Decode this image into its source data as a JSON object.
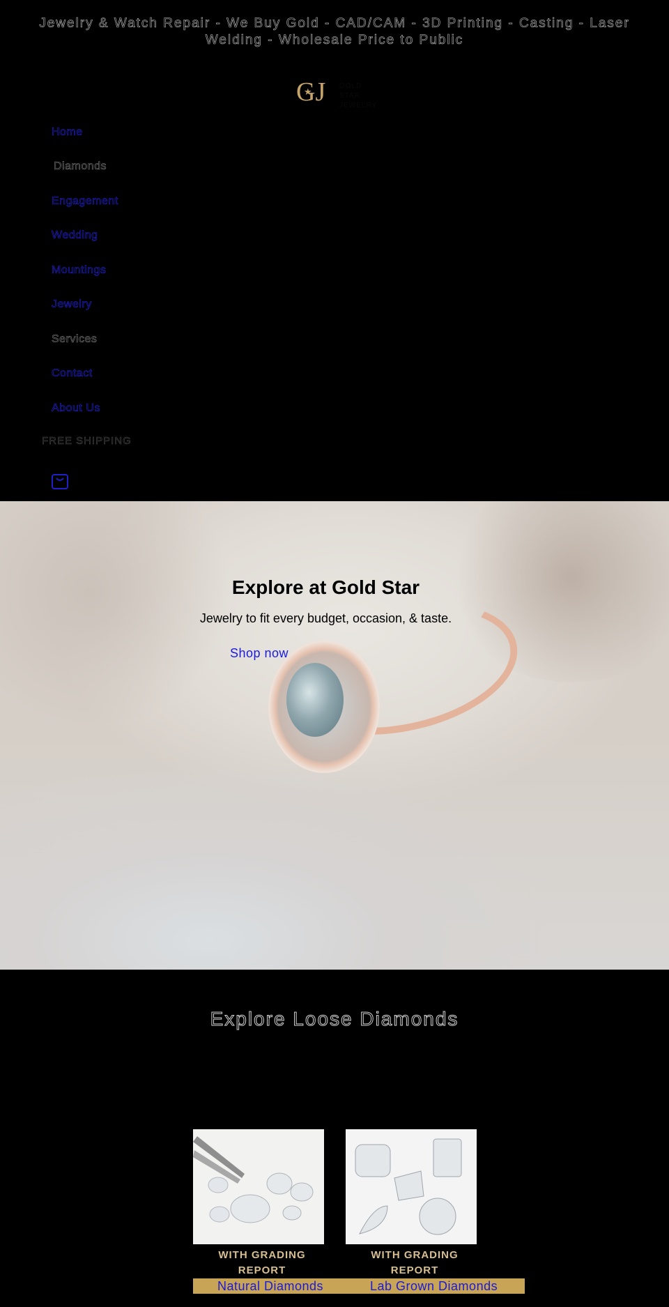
{
  "announcement": "Jewelry & Watch Repair - We Buy Gold - CAD/CAM - 3D Printing - Casting - Laser Welding - Wholesale Price to Public",
  "logo": {
    "mark": "GJ",
    "line1": "GOLD STAR",
    "line2": "JEWELRY"
  },
  "nav": {
    "items": [
      {
        "label": "Home"
      },
      {
        "label": "Diamonds"
      },
      {
        "label": "Engagement"
      },
      {
        "label": "Wedding"
      },
      {
        "label": "Mountings"
      },
      {
        "label": "Jewelry"
      },
      {
        "label": "Services"
      },
      {
        "label": "Contact"
      },
      {
        "label": "About Us"
      }
    ],
    "free_shipping": "FREE SHIPPING",
    "cart_icon": "shopping-bag-icon"
  },
  "hero": {
    "title": "Explore at Gold Star",
    "subtitle": "Jewelry to fit every budget, occasion, & taste.",
    "cta": "Shop now"
  },
  "loose_diamonds": {
    "title": "Explore Loose Diamonds",
    "cards": [
      {
        "label": "WITH GRADING REPORT",
        "link": "Natural Diamonds"
      },
      {
        "label": "WITH GRADING REPORT",
        "link": "Lab Grown Diamonds"
      }
    ]
  },
  "colors": {
    "background": "#000000",
    "gold": "#c7a456",
    "link_blue": "#1a1ae0",
    "label_gold": "#d8bf90"
  }
}
